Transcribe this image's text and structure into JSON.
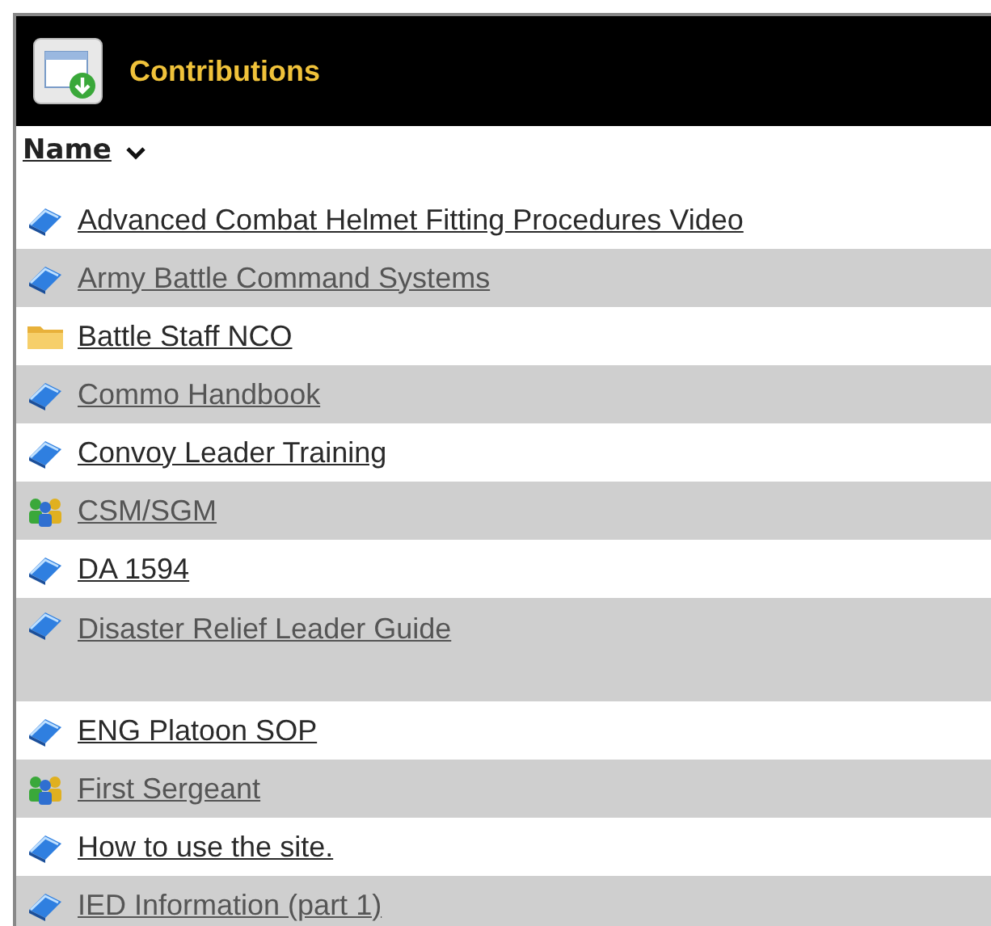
{
  "header": {
    "title": "Contributions"
  },
  "column": {
    "label": "Name",
    "sort_descending": true
  },
  "rows": [
    {
      "kind": "book",
      "label": "Advanced Combat Helmet Fitting Procedures Video"
    },
    {
      "kind": "book",
      "label": "Army Battle Command Systems"
    },
    {
      "kind": "folder",
      "label": "Battle Staff NCO"
    },
    {
      "kind": "book",
      "label": "Commo Handbook"
    },
    {
      "kind": "book",
      "label": "Convoy Leader Training"
    },
    {
      "kind": "group",
      "label": "CSM/SGM"
    },
    {
      "kind": "book",
      "label": "DA 1594"
    },
    {
      "kind": "book",
      "label": "Disaster Relief Leader Guide",
      "tall": true
    },
    {
      "kind": "book",
      "label": "ENG Platoon SOP"
    },
    {
      "kind": "group",
      "label": "First Sergeant"
    },
    {
      "kind": "book",
      "label": "How to use the site."
    },
    {
      "kind": "book",
      "label": "IED Information (part 1)"
    }
  ]
}
